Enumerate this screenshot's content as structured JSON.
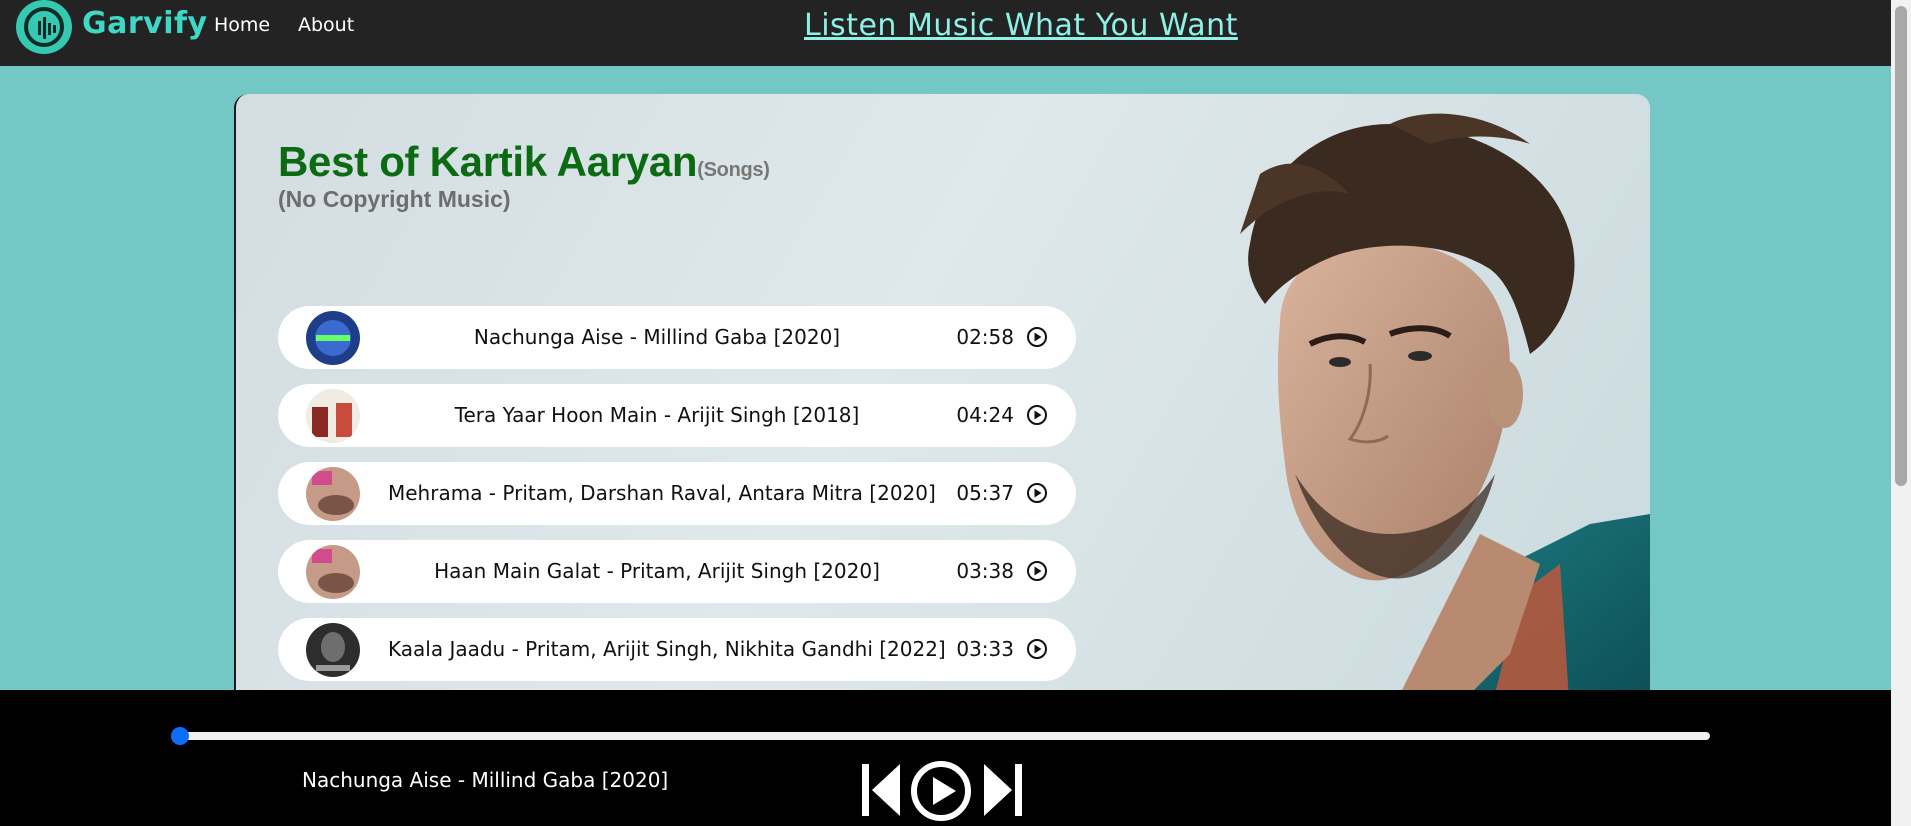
{
  "brand": {
    "name": "Garvify"
  },
  "nav": {
    "links": [
      {
        "label": "Home"
      },
      {
        "label": "About"
      }
    ],
    "tagline": "Listen Music What You Want"
  },
  "playlist": {
    "title": "Best of Kartik Aaryan",
    "title_suffix": "(Songs)",
    "subtitle": "(No Copyright Music)"
  },
  "songs": [
    {
      "name": "Nachunga Aise - Millind Gaba [2020]",
      "duration": "02:58"
    },
    {
      "name": "Tera Yaar Hoon Main - Arijit Singh [2018]",
      "duration": "04:24"
    },
    {
      "name": "Mehrama - Pritam, Darshan Raval, Antara Mitra [2020]",
      "duration": "05:37"
    },
    {
      "name": "Haan Main Galat - Pritam, Arijit Singh [2020]",
      "duration": "03:38"
    },
    {
      "name": "Kaala Jaadu - Pritam, Arijit Singh, Nikhita Gandhi [2022]",
      "duration": "03:33"
    }
  ],
  "player": {
    "now_playing": "Nachunga Aise - Millind Gaba [2020]",
    "progress_percent": 0
  },
  "colors": {
    "page_bg": "#73c8c6",
    "navbar_bg": "#232323",
    "brand": "#3fd7c6",
    "title": "#0b6b12",
    "player_bg": "#000000",
    "progress_accent": "#0d6efd"
  },
  "icons": {
    "logo": "garvify-logo-icon",
    "song_play": "play-circle-icon",
    "prev": "skip-previous-icon",
    "play": "play-icon",
    "next": "skip-next-icon"
  }
}
